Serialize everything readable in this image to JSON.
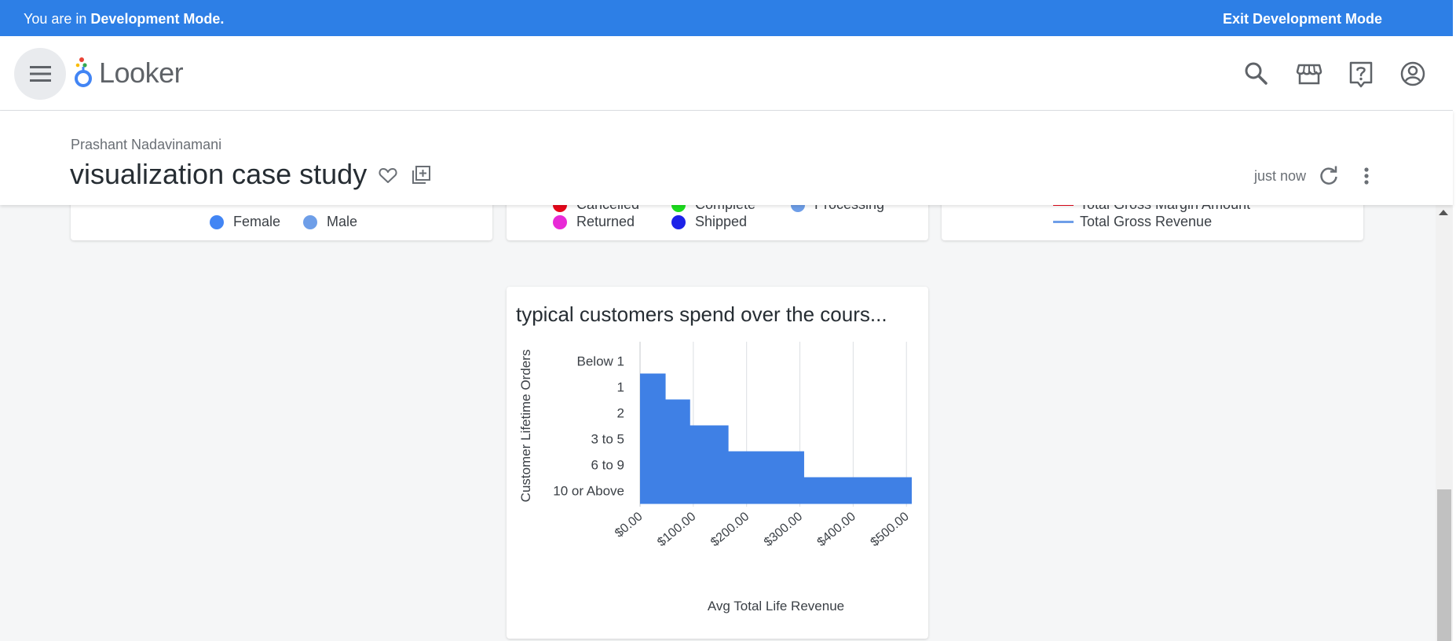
{
  "banner": {
    "prefix": "You are in ",
    "mode": "Development Mode.",
    "exit_label": "Exit Development Mode"
  },
  "header": {
    "app_name": "Looker",
    "icons": [
      "menu-icon",
      "search-icon",
      "marketplace-icon",
      "help-icon",
      "account-icon"
    ]
  },
  "dashboard": {
    "owner": "Prashant Nadavinamani",
    "title": "visualization case study",
    "updated": "just now",
    "icons": [
      "heart-icon",
      "add-to-board-icon",
      "refresh-icon",
      "more-vert-icon"
    ]
  },
  "tiles": {
    "gender_legend": [
      {
        "label": "Female",
        "color": "#4285f4"
      },
      {
        "label": "Male",
        "color": "#6e9ee8"
      }
    ],
    "status_legend": [
      {
        "label": "Cancelled",
        "color": "#e8071a"
      },
      {
        "label": "Complete",
        "color": "#1cde1e"
      },
      {
        "label": "Processing",
        "color": "#6e9ee8"
      },
      {
        "label": "Returned",
        "color": "#e82ad6"
      },
      {
        "label": "Shipped",
        "color": "#1d22e8"
      }
    ],
    "margin_legend": [
      {
        "label": "Total Gross Margin Amount",
        "color": "#e8071a"
      },
      {
        "label": "Total Gross Revenue",
        "color": "#6e9ee8"
      }
    ]
  },
  "chart_data": {
    "type": "bar",
    "orientation": "horizontal",
    "title": "typical customers spend over the cours...",
    "xlabel": "Avg Total Life Revenue",
    "ylabel": "Customer Lifetime Orders",
    "categories": [
      "Below 1",
      "1",
      "2",
      "3 to 5",
      "6 to 9",
      "10 or Above"
    ],
    "values": [
      0,
      24,
      47,
      83,
      154,
      255
    ],
    "xlim": [
      0,
      255
    ],
    "xticks": [
      0,
      50,
      100,
      150,
      200,
      250
    ],
    "xtick_labels": [
      "$0.00",
      "$100.00",
      "$200.00",
      "$300.00",
      "$400.00",
      "$500.00"
    ],
    "bar_color": "#3f80e5",
    "grid": true
  }
}
